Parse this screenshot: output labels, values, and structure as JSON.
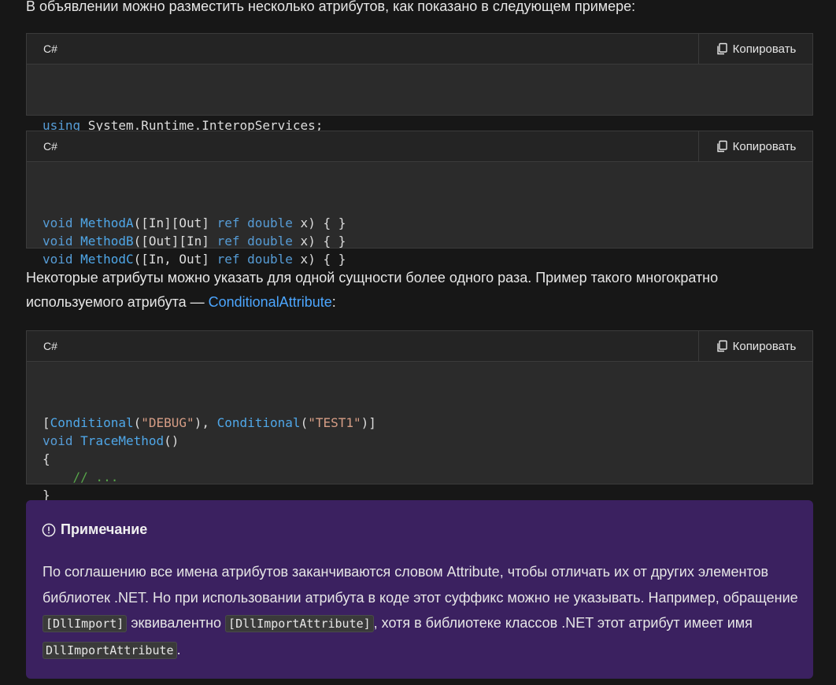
{
  "intro_text": "В объявлении можно разместить несколько атрибутов, как показано в следующем примере:",
  "copy_label": "Копировать",
  "code_blocks": [
    {
      "lang": "C#",
      "lines": [
        [
          {
            "t": "using",
            "c": "kw"
          },
          {
            "t": " System.Runtime.InteropServices;",
            "c": ""
          }
        ]
      ]
    },
    {
      "lang": "C#",
      "lines": [
        [
          {
            "t": "void",
            "c": "kw"
          },
          {
            "t": " ",
            "c": ""
          },
          {
            "t": "MethodA",
            "c": "fn"
          },
          {
            "t": "([In][Out] ",
            "c": ""
          },
          {
            "t": "ref",
            "c": "kw"
          },
          {
            "t": " ",
            "c": ""
          },
          {
            "t": "double",
            "c": "kw"
          },
          {
            "t": " x) { }",
            "c": ""
          }
        ],
        [
          {
            "t": "void",
            "c": "kw"
          },
          {
            "t": " ",
            "c": ""
          },
          {
            "t": "MethodB",
            "c": "fn"
          },
          {
            "t": "([Out][In] ",
            "c": ""
          },
          {
            "t": "ref",
            "c": "kw"
          },
          {
            "t": " ",
            "c": ""
          },
          {
            "t": "double",
            "c": "kw"
          },
          {
            "t": " x) { }",
            "c": ""
          }
        ],
        [
          {
            "t": "void",
            "c": "kw"
          },
          {
            "t": " ",
            "c": ""
          },
          {
            "t": "MethodC",
            "c": "fn"
          },
          {
            "t": "([In, Out] ",
            "c": ""
          },
          {
            "t": "ref",
            "c": "kw"
          },
          {
            "t": " ",
            "c": ""
          },
          {
            "t": "double",
            "c": "kw"
          },
          {
            "t": " x) { }",
            "c": ""
          }
        ]
      ]
    },
    {
      "lang": "C#",
      "lines": [
        [
          {
            "t": "[",
            "c": ""
          },
          {
            "t": "Conditional",
            "c": "attr"
          },
          {
            "t": "(",
            "c": ""
          },
          {
            "t": "\"DEBUG\"",
            "c": "str"
          },
          {
            "t": "), ",
            "c": ""
          },
          {
            "t": "Conditional",
            "c": "attr"
          },
          {
            "t": "(",
            "c": ""
          },
          {
            "t": "\"TEST1\"",
            "c": "str"
          },
          {
            "t": ")]",
            "c": ""
          }
        ],
        [
          {
            "t": "void",
            "c": "kw"
          },
          {
            "t": " ",
            "c": ""
          },
          {
            "t": "TraceMethod",
            "c": "fn"
          },
          {
            "t": "()",
            "c": ""
          }
        ],
        [
          {
            "t": "{",
            "c": ""
          }
        ],
        [
          {
            "t": "    ",
            "c": ""
          },
          {
            "t": "// ...",
            "c": "cm"
          }
        ],
        [
          {
            "t": "}",
            "c": ""
          }
        ]
      ]
    }
  ],
  "paragraph2": {
    "text_before": "Некоторые атрибуты можно указать для одной сущности более одного раза. Пример такого многократно используемого атрибута — ",
    "link_text": "ConditionalAttribute",
    "text_after": ":"
  },
  "note": {
    "title": "Примечание",
    "part1": "По соглашению все имена атрибутов заканчиваются словом Attribute, чтобы отличать их от других элементов библиотек .NET. Но при использовании атрибута в коде этот суффикс можно не указывать. Например, обращение ",
    "code1": "[DllImport]",
    "part2": " эквивалентно ",
    "code2": "[DllImportAttribute]",
    "part3": ", хотя в библиотеке классов .NET этот атрибут имеет имя ",
    "code3": "DllImportAttribute",
    "part4": "."
  },
  "colors": {
    "background": "#171717",
    "code_bg": "#2b2b2b",
    "keyword": "#569cd6",
    "string": "#d69d85",
    "comment": "#57a64a",
    "link": "#4ca6ff",
    "note_bg": "#3b2160"
  }
}
